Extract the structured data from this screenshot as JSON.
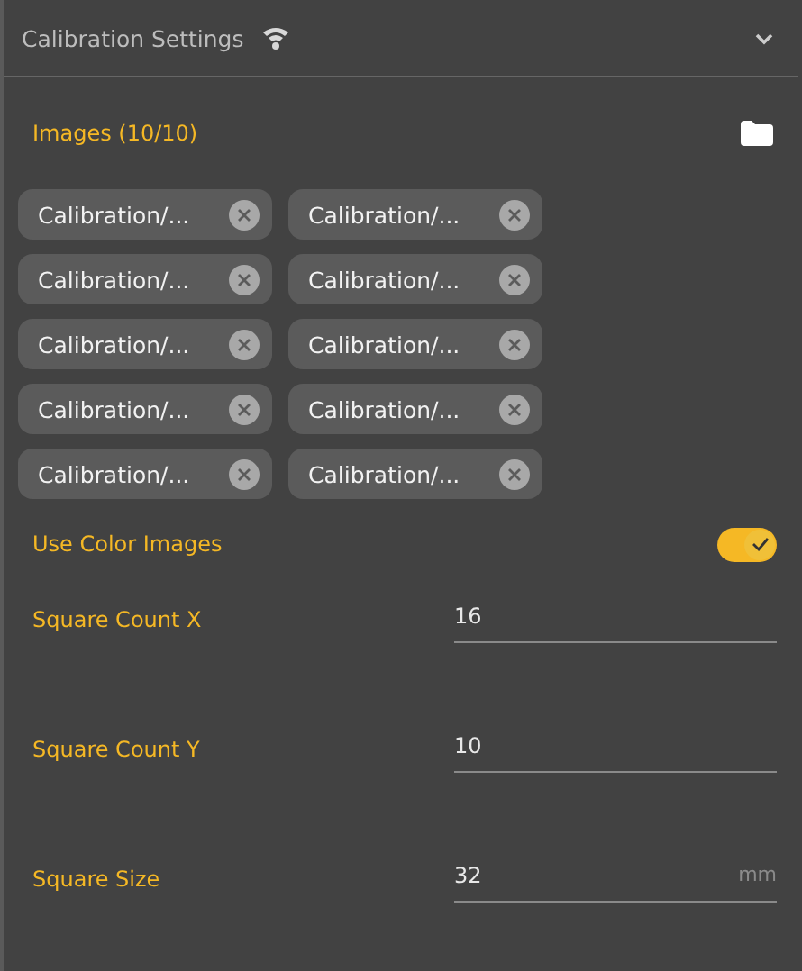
{
  "panel": {
    "title": "Calibration Settings",
    "expanded": true
  },
  "images": {
    "label": "Images (10/10)",
    "files": [
      {
        "name": "Calibration/..."
      },
      {
        "name": "Calibration/..."
      },
      {
        "name": "Calibration/..."
      },
      {
        "name": "Calibration/..."
      },
      {
        "name": "Calibration/..."
      },
      {
        "name": "Calibration/..."
      },
      {
        "name": "Calibration/..."
      },
      {
        "name": "Calibration/..."
      },
      {
        "name": "Calibration/..."
      },
      {
        "name": "Calibration/..."
      }
    ]
  },
  "use_color_images": {
    "label": "Use Color Images",
    "on": true
  },
  "fields": [
    {
      "label": "Square Count X",
      "value": "16"
    },
    {
      "label": "Square Count Y",
      "value": "10"
    },
    {
      "label": "Square Size",
      "value": "32",
      "unit": "mm"
    }
  ]
}
